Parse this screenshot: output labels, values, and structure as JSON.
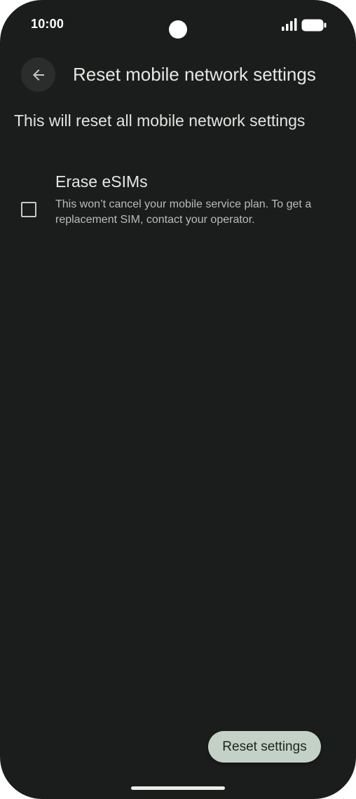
{
  "status_bar": {
    "time": "10:00",
    "signal_icon": "cell-signal-icon",
    "battery_icon": "battery-icon"
  },
  "header": {
    "back_icon": "arrow-back-icon",
    "title": "Reset mobile network settings"
  },
  "description": "This will reset all mobile network settings",
  "options": [
    {
      "title": "Erase eSIMs",
      "subtitle": "This won’t cancel your mobile service plan. To get a replacement SIM, contact your operator.",
      "checked": false
    }
  ],
  "reset_button": {
    "label": "Reset settings"
  },
  "colors": {
    "background": "#1b1d1c",
    "button_fill": "#c3d1c6",
    "text_primary": "#e6e6e3",
    "text_secondary": "#b9bcb8"
  }
}
